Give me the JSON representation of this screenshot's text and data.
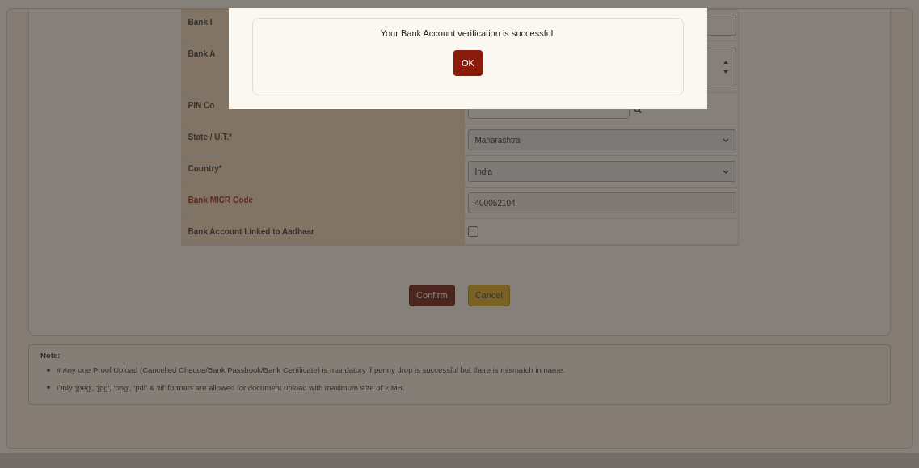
{
  "form": {
    "rows": [
      {
        "kind": "text",
        "label": "Bank I",
        "required_color": false
      },
      {
        "kind": "spin",
        "label": "Bank A",
        "required_color": false
      },
      {
        "kind": "search",
        "label": "PIN Co",
        "required_color": false
      },
      {
        "kind": "select",
        "label": "State / U.T.*",
        "value": "Maharashtra",
        "required_color": false
      },
      {
        "kind": "select",
        "label": "Country*",
        "value": "India",
        "required_color": false
      },
      {
        "kind": "text",
        "label": "Bank MICR Code",
        "value": "400052104",
        "required_color": true
      },
      {
        "kind": "checkbox",
        "label": "Bank Account Linked to Aadhaar",
        "checked": false,
        "required_color": false
      }
    ]
  },
  "buttons": [
    {
      "kind": "primary",
      "label": "Confirm"
    },
    {
      "kind": "secondary",
      "label": "Cancel"
    }
  ],
  "note": {
    "title": "Note:",
    "items": [
      "# Any one Proof Upload (Cancelled Cheque/Bank Passbook/Bank Certificate) is mandatory if penny drop is successful but there is mismatch in name.",
      "Only 'jpeg', 'jpg', 'png', 'pdf' & 'tif' formats are allowed for document upload with maximum size of 2 MB."
    ]
  },
  "dialog": {
    "message": "Your Bank Account verification is successful.",
    "button": "OK"
  }
}
